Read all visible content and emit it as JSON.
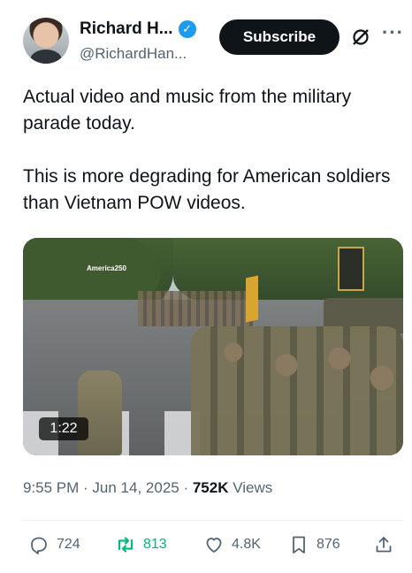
{
  "author": {
    "name": "Richard H...",
    "handle": "@RichardHan...",
    "subscribe_label": "Subscribe"
  },
  "icons": {
    "verified": "verified-badge-icon",
    "grok": "grok-icon",
    "more": "more-icon",
    "reply": "reply-icon",
    "retweet": "retweet-icon",
    "like": "heart-icon",
    "bookmark": "bookmark-icon",
    "share": "share-icon"
  },
  "tweet": {
    "text": "Actual video and music from the military parade today.\n\nThis is more degrading for American soldiers than Vietnam POW videos."
  },
  "media": {
    "duration": "1:22",
    "watermark": "America250"
  },
  "meta": {
    "time": "9:55 PM",
    "separator": " · ",
    "date": "Jun 14, 2025",
    "views_count": "752K",
    "views_label": " Views"
  },
  "stats": {
    "replies": "724",
    "retweets": "813",
    "likes": "4.8K",
    "bookmarks": "876"
  },
  "colors": {
    "accent": "#1d9bf0",
    "retweet_active": "#00ba7c",
    "text_secondary": "#536471",
    "subscribe_bg": "#0f1419"
  }
}
